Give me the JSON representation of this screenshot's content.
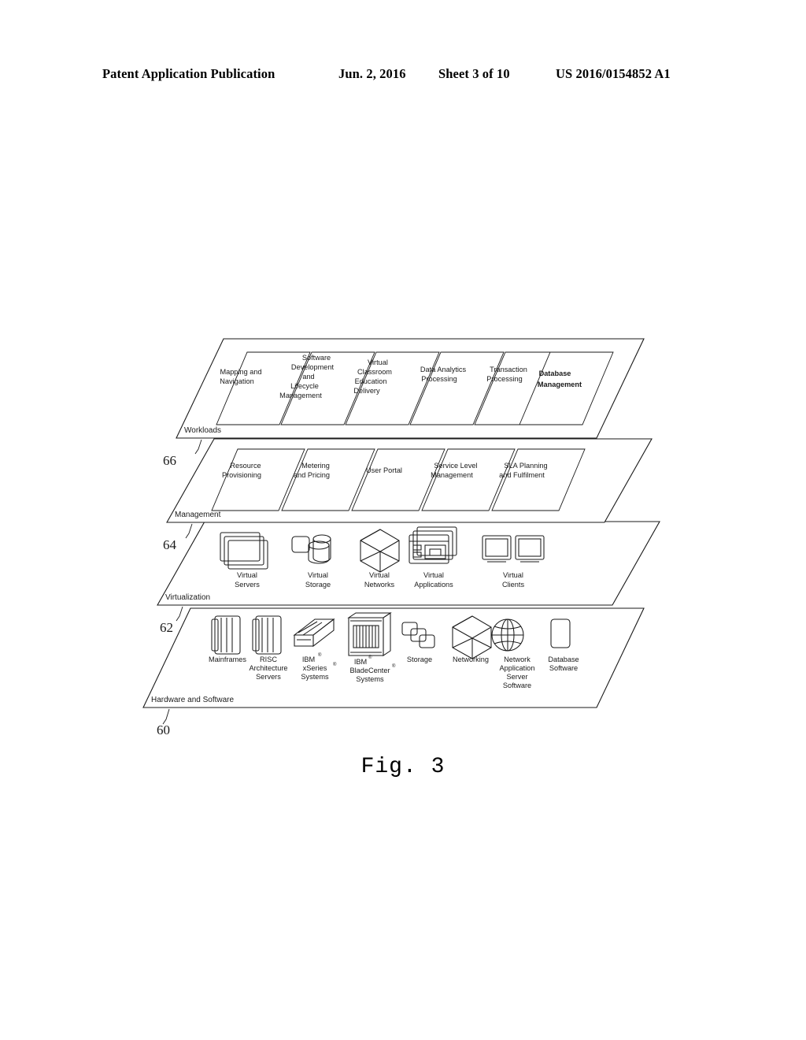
{
  "header": {
    "title": "Patent Application Publication",
    "date": "Jun. 2, 2016",
    "sheet": "Sheet 3 of 10",
    "publication_number": "US 2016/0154852 A1"
  },
  "figure": {
    "caption": "Fig. 3",
    "reference_numerals": {
      "hardware_and_software": "60",
      "virtualization": "62",
      "management": "64",
      "workloads": "66"
    }
  },
  "layers": {
    "workloads": {
      "label": "Workloads",
      "ref": "66",
      "items": [
        {
          "lines": [
            "Mapping and",
            "Navigation"
          ],
          "bold": false
        },
        {
          "lines": [
            "Software",
            "Development",
            "and",
            "Lifecycle",
            "Management"
          ],
          "bold": false
        },
        {
          "lines": [
            "Virtual",
            "Classroom",
            "Education",
            "Delivery"
          ],
          "bold": false
        },
        {
          "lines": [
            "Data Analytics",
            "Processing"
          ],
          "bold": false
        },
        {
          "lines": [
            "Transaction",
            "Processing"
          ],
          "bold": false
        },
        {
          "lines": [
            "Database",
            "Management"
          ],
          "bold": true
        }
      ]
    },
    "management": {
      "label": "Management",
      "ref": "64",
      "items": [
        {
          "lines": [
            "Resource",
            "Provisioning"
          ],
          "bold": false
        },
        {
          "lines": [
            "Metering",
            "and Pricing"
          ],
          "bold": false
        },
        {
          "lines": [
            "User Portal"
          ],
          "bold": false
        },
        {
          "lines": [
            "Service Level",
            "Management"
          ],
          "bold": false
        },
        {
          "lines": [
            "SLA Planning",
            "and Fulfilment"
          ],
          "bold": false
        }
      ]
    },
    "virtualization": {
      "label": "Virtualization",
      "ref": "62",
      "items": [
        {
          "lines": [
            "Virtual",
            "Servers"
          ],
          "icon": "stacked-screens-icon"
        },
        {
          "lines": [
            "Virtual",
            "Storage"
          ],
          "icon": "storage-cylinders-icon"
        },
        {
          "lines": [
            "Virtual",
            "Networks"
          ],
          "icon": "network-cube-icon"
        },
        {
          "lines": [
            "Virtual",
            "Applications"
          ],
          "icon": "stacked-windows-icon"
        },
        {
          "lines": [
            "Virtual",
            "Clients"
          ],
          "icon": "two-monitors-icon"
        }
      ]
    },
    "hardware_and_software": {
      "label": "Hardware and Software",
      "ref": "60",
      "items": [
        {
          "lines": [
            "Mainframes"
          ],
          "icon": "mainframe-cabinet-icon"
        },
        {
          "lines": [
            "RISC",
            "Architecture",
            "Servers"
          ],
          "icon": "risc-cabinet-icon"
        },
        {
          "lines": [
            "IBM",
            "xSeries",
            "Systems"
          ],
          "icon": "rack-server-icon",
          "trademarks": [
            "®",
            "®"
          ]
        },
        {
          "lines": [
            "IBM",
            "BladeCenter",
            "Systems"
          ],
          "icon": "bladecenter-icon",
          "trademarks": [
            "®",
            "®"
          ]
        },
        {
          "lines": [
            "Storage"
          ],
          "icon": "storage-tiles-icon"
        },
        {
          "lines": [
            "Networking"
          ],
          "icon": "network-cube-icon"
        },
        {
          "lines": [
            "Network",
            "Application",
            "Server",
            "Software"
          ],
          "icon": "globe-icon"
        },
        {
          "lines": [
            "Database",
            "Software"
          ],
          "icon": "database-tablet-icon"
        }
      ]
    }
  }
}
